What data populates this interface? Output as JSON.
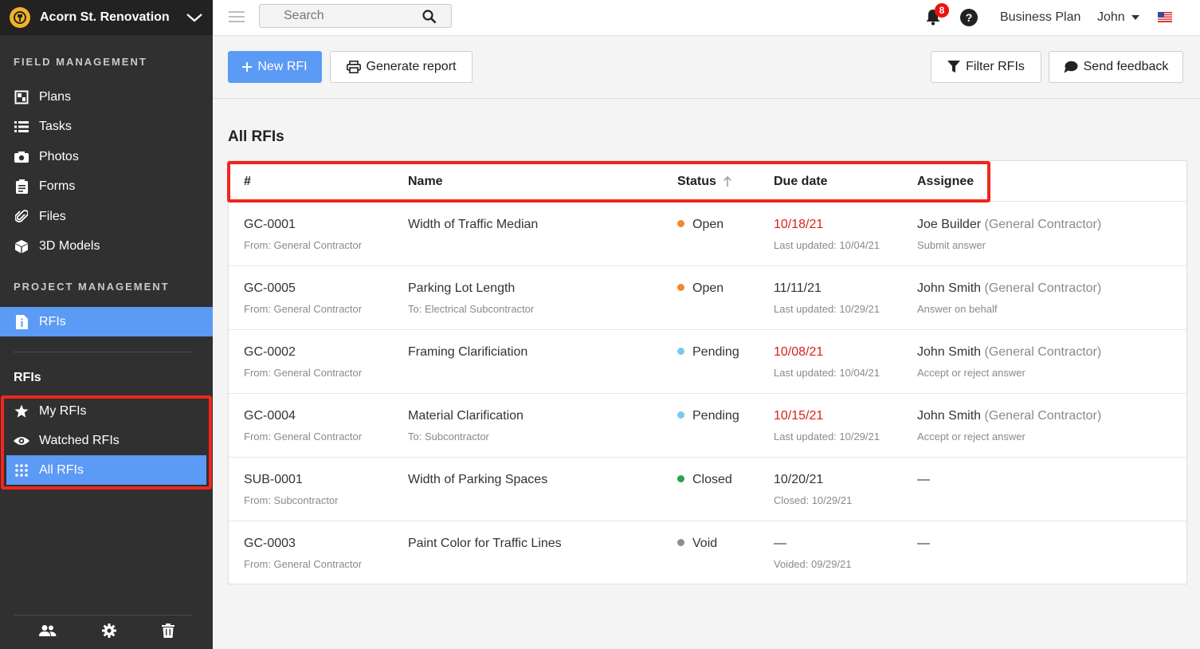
{
  "project": {
    "name": "Acorn St. Renovation"
  },
  "sidebar": {
    "field_label": "FIELD MANAGEMENT",
    "field_items": [
      {
        "label": "Plans",
        "icon": "plans-icon"
      },
      {
        "label": "Tasks",
        "icon": "tasks-icon"
      },
      {
        "label": "Photos",
        "icon": "camera-icon"
      },
      {
        "label": "Forms",
        "icon": "clipboard-icon"
      },
      {
        "label": "Files",
        "icon": "paperclip-icon"
      },
      {
        "label": "3D Models",
        "icon": "cube-icon"
      }
    ],
    "project_label": "PROJECT MANAGEMENT",
    "project_items": [
      {
        "label": "RFIs",
        "icon": "rfi-icon",
        "active": true
      }
    ],
    "rfis_heading": "RFIs",
    "rfi_filters": [
      {
        "label": "My RFIs",
        "icon": "star-icon"
      },
      {
        "label": "Watched RFIs",
        "icon": "eye-icon"
      },
      {
        "label": "All RFIs",
        "icon": "grid-icon",
        "active": true
      }
    ]
  },
  "topbar": {
    "search_placeholder": "Search",
    "notification_count": "8",
    "help": "?",
    "plan": "Business Plan",
    "user": "John"
  },
  "toolbar": {
    "new_rfi": "New RFI",
    "generate_report": "Generate report",
    "filter": "Filter RFIs",
    "feedback": "Send feedback"
  },
  "main": {
    "title": "All RFIs",
    "columns": {
      "num": "#",
      "name": "Name",
      "status": "Status",
      "due": "Due date",
      "assignee": "Assignee"
    },
    "rows": [
      {
        "id": "GC-0001",
        "from": "From: General Contractor",
        "name": "Width of Traffic Median",
        "to": "",
        "status": "Open",
        "status_color": "#f0892a",
        "due": "10/18/21",
        "due_overdue": true,
        "due_sub": "Last updated: 10/04/21",
        "assignee": "Joe Builder",
        "assignee_org": " (General Contractor)",
        "assignee_sub": "Submit answer"
      },
      {
        "id": "GC-0005",
        "from": "From: General Contractor",
        "name": "Parking Lot Length",
        "to": "To: Electrical Subcontractor",
        "status": "Open",
        "status_color": "#f0892a",
        "due": "11/11/21",
        "due_overdue": false,
        "due_sub": "Last updated: 10/29/21",
        "assignee": "John Smith",
        "assignee_org": " (General Contractor)",
        "assignee_sub": "Answer on behalf"
      },
      {
        "id": "GC-0002",
        "from": "From: General Contractor",
        "name": "Framing Clarificiation",
        "to": "",
        "status": "Pending",
        "status_color": "#79c7f2",
        "due": "10/08/21",
        "due_overdue": true,
        "due_sub": "Last updated: 10/04/21",
        "assignee": "John Smith",
        "assignee_org": " (General Contractor)",
        "assignee_sub": "Accept or reject answer"
      },
      {
        "id": "GC-0004",
        "from": "From: General Contractor",
        "name": "Material Clarification",
        "to": "To: Subcontractor",
        "status": "Pending",
        "status_color": "#79c7f2",
        "due": "10/15/21",
        "due_overdue": true,
        "due_sub": "Last updated: 10/29/21",
        "assignee": "John Smith",
        "assignee_org": " (General Contractor)",
        "assignee_sub": "Accept or reject answer"
      },
      {
        "id": "SUB-0001",
        "from": "From: Subcontractor",
        "name": "Width of Parking Spaces",
        "to": "",
        "status": "Closed",
        "status_color": "#2aa14a",
        "due": "10/20/21",
        "due_overdue": false,
        "due_sub": "Closed: 10/29/21",
        "assignee": "—",
        "assignee_org": "",
        "assignee_sub": ""
      },
      {
        "id": "GC-0003",
        "from": "From: General Contractor",
        "name": "Paint Color for Traffic Lines",
        "to": "",
        "status": "Void",
        "status_color": "#8d8d8d",
        "due": "—",
        "due_overdue": false,
        "due_sub": "Voided: 09/29/21",
        "assignee": "—",
        "assignee_org": "",
        "assignee_sub": ""
      }
    ]
  },
  "colors": {
    "accent": "#5b9af5",
    "highlight": "#f0261c",
    "overdue": "#d9201c"
  }
}
